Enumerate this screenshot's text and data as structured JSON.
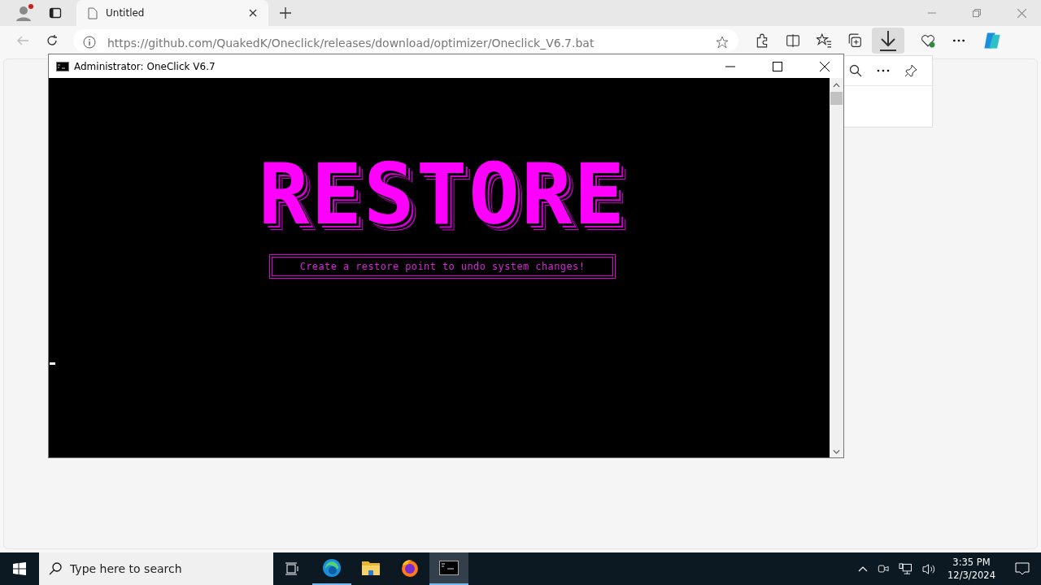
{
  "browser": {
    "tabs": [
      {
        "title": "Untitled",
        "selected": true
      }
    ],
    "address": "https://github.com/QuakedK/Oneclick/releases/download/optimizer/Oneclick_V6.7.bat"
  },
  "console": {
    "title": "Administrator:  OneClick V6.7",
    "banner": "RESTORE",
    "message": "Create a restore point to undo system changes!"
  },
  "taskbar": {
    "search_placeholder": "Type here to search",
    "apps": [
      {
        "kind": "edge",
        "running": true,
        "selected": false
      },
      {
        "kind": "explorer",
        "running": false,
        "selected": false
      },
      {
        "kind": "firefox",
        "running": false,
        "selected": false
      },
      {
        "kind": "terminal",
        "running": true,
        "selected": true
      }
    ],
    "time": "3:35 PM",
    "date": "12/3/2024"
  }
}
